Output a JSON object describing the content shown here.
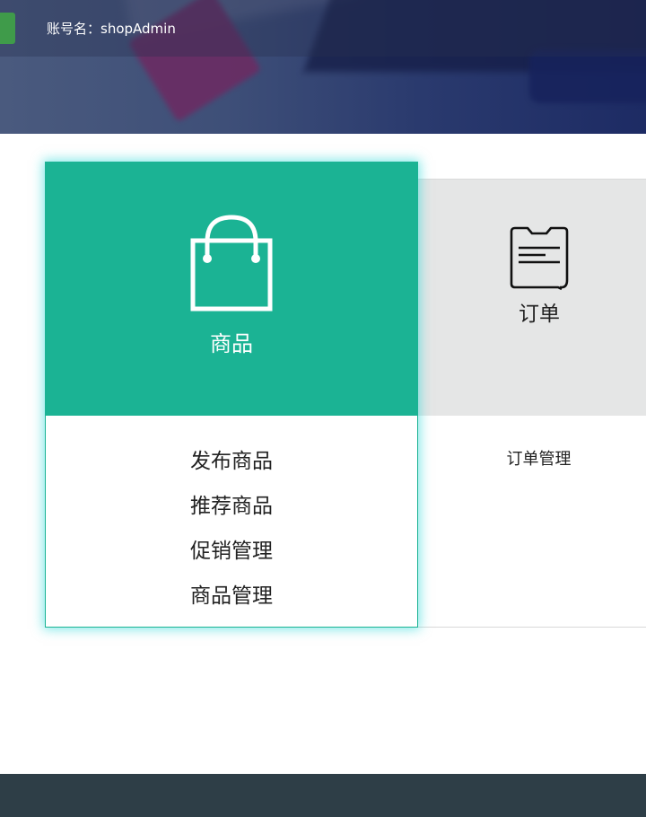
{
  "header": {
    "account_label": "账号名：shopAdmin"
  },
  "modules": {
    "products": {
      "title": "商品",
      "icon": "shopping-bag-icon",
      "color": "#1bb394",
      "menu": [
        "发布商品",
        "推荐商品",
        "促销管理",
        "商品管理"
      ]
    },
    "orders": {
      "title": "订单",
      "icon": "order-document-icon",
      "color": "#e5e6e6",
      "menu": [
        "订单管理"
      ]
    }
  },
  "colors": {
    "accent": "#1bb394",
    "footer": "#2e3e47",
    "highlight_glow": "#1ad6d6"
  }
}
